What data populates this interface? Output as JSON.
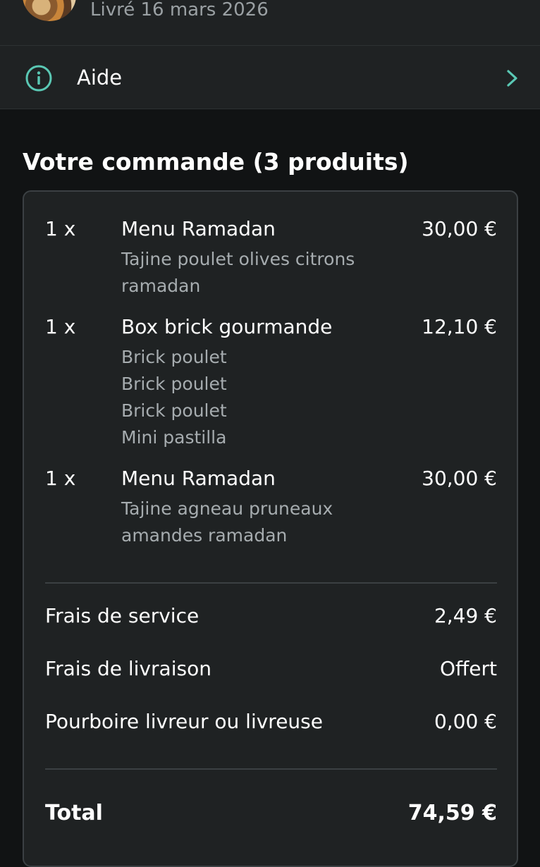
{
  "header": {
    "delivered_text": "Livré 16 mars 2026",
    "avatar_icon": "restaurant-avatar"
  },
  "help": {
    "icon": "info-icon",
    "label": "Aide",
    "chevron": "chevron-right-icon"
  },
  "order": {
    "title": "Votre commande (3 produits)",
    "items": [
      {
        "qty": "1 x",
        "name": "Menu Ramadan",
        "price": "30,00 €",
        "details": [
          "Tajine poulet olives citrons",
          "ramadan"
        ]
      },
      {
        "qty": "1 x",
        "name": "Box brick gourmande",
        "price": "12,10 €",
        "details": [
          "Brick poulet",
          "Brick poulet",
          "Brick poulet",
          "Mini pastilla"
        ]
      },
      {
        "qty": "1 x",
        "name": "Menu Ramadan",
        "price": "30,00 €",
        "details": [
          "Tajine agneau pruneaux",
          "amandes ramadan"
        ]
      }
    ],
    "fees": [
      {
        "label": "Frais de service",
        "value": "2,49 €"
      },
      {
        "label": "Frais de livraison",
        "value": "Offert"
      },
      {
        "label": "Pourboire livreur ou livreuse",
        "value": "0,00 €"
      }
    ],
    "total": {
      "label": "Total",
      "value": "74,59 €"
    }
  },
  "colors": {
    "accent": "#5ac8b4",
    "background": "#111314",
    "card": "#1f2223",
    "secondary_text": "#a6acaf"
  }
}
